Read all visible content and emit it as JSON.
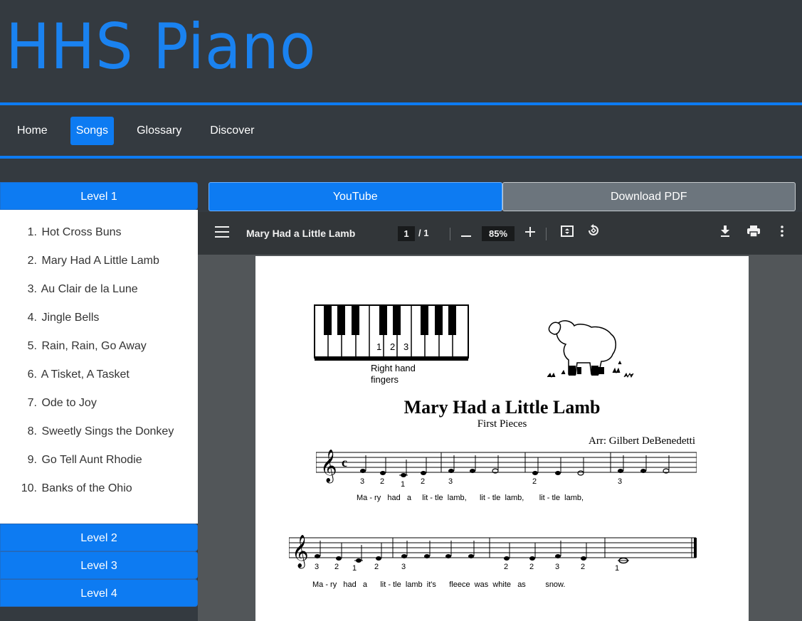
{
  "site": {
    "title": "HHS Piano"
  },
  "nav": [
    {
      "label": "Home",
      "active": false
    },
    {
      "label": "Songs",
      "active": true
    },
    {
      "label": "Glossary",
      "active": false
    },
    {
      "label": "Discover",
      "active": false
    }
  ],
  "levels": {
    "level1": "Level 1",
    "level2": "Level 2",
    "level3": "Level 3",
    "level4": "Level 4"
  },
  "songs": [
    {
      "num": "1.",
      "title": "Hot Cross Buns"
    },
    {
      "num": "2.",
      "title": "Mary Had A Little Lamb"
    },
    {
      "num": "3.",
      "title": "Au Clair de la Lune"
    },
    {
      "num": "4.",
      "title": "Jingle Bells"
    },
    {
      "num": "5.",
      "title": "Rain, Rain, Go Away"
    },
    {
      "num": "6.",
      "title": "A Tisket, A Tasket"
    },
    {
      "num": "7.",
      "title": "Ode to Joy"
    },
    {
      "num": "8.",
      "title": "Sweetly Sings the Donkey"
    },
    {
      "num": "9.",
      "title": "Go Tell Aunt Rhodie"
    },
    {
      "num": "10.",
      "title": "Banks of the Ohio"
    }
  ],
  "tabs": {
    "youtube": "YouTube",
    "download": "Download PDF"
  },
  "viewer": {
    "doc_title": "Mary Had a Little Lamb",
    "page_current": "1",
    "page_total": "/ 1",
    "zoom": "85%",
    "icons": [
      "menu-icon",
      "zoom-out-icon",
      "zoom-in-icon",
      "fit-page-icon",
      "rotate-icon",
      "download-icon",
      "print-icon",
      "more-icon"
    ]
  },
  "sheet": {
    "title": "Mary Had a Little Lamb",
    "subtitle": "First Pieces",
    "arranger": "Arr: Gilbert DeBenedetti",
    "fingers_caption_1": "Right hand",
    "fingers_caption_2": "fingers",
    "key_numbers": [
      "1",
      "2",
      "3"
    ],
    "lyrics_line1": "Ma - ry   had   a     lit - tle  lamb,      lit - tle  lamb,       lit - tle  lamb,",
    "lyrics_line2": "Ma - ry   had   a      lit - tle  lamb  it's      fleece  was  white   as         snow.",
    "fingering_line1": [
      "3",
      "2",
      "1",
      "2",
      "3",
      "2",
      "3"
    ],
    "fingering_line2": [
      "3",
      "2",
      "1",
      "2",
      "3",
      "2",
      "2",
      "3",
      "2",
      "1"
    ]
  },
  "colors": {
    "accent": "#0d7bf2",
    "header_bg": "#343a40",
    "secondary": "#6c757d",
    "viewer_toolbar": "#323639",
    "viewer_bg": "#525659"
  }
}
